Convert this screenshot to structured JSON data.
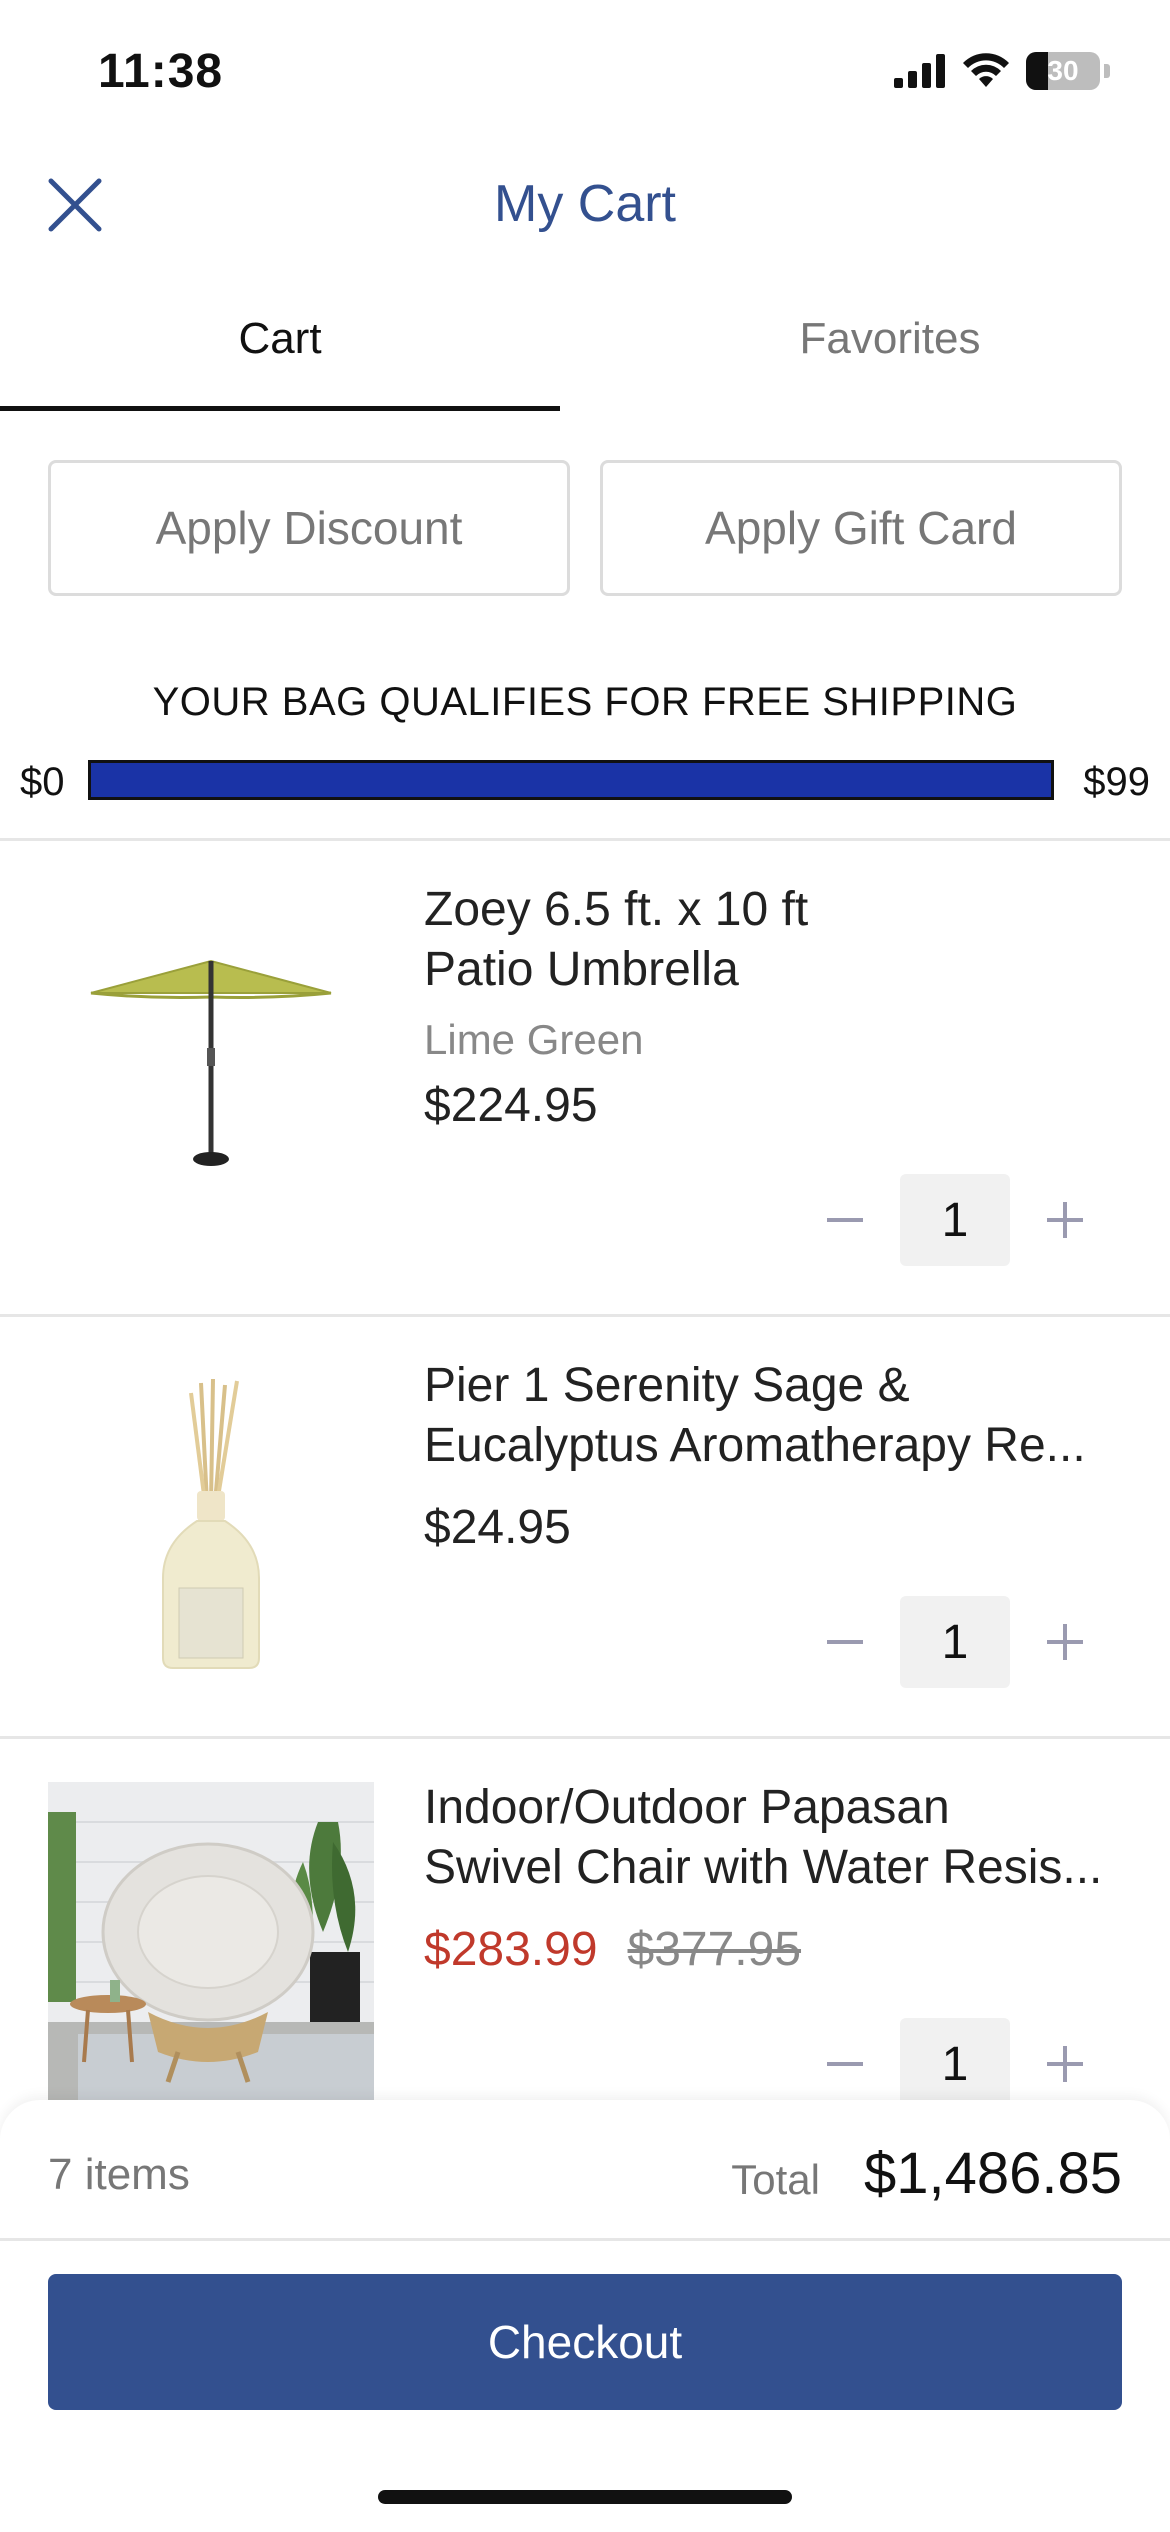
{
  "status_bar": {
    "time": "11:38",
    "battery": "30"
  },
  "header": {
    "title": "My Cart",
    "close_icon": "close-icon"
  },
  "tabs": [
    {
      "label": "Cart",
      "active": true
    },
    {
      "label": "Favorites",
      "active": false
    }
  ],
  "actions": {
    "discount_label": "Apply Discount",
    "gift_card_label": "Apply Gift Card"
  },
  "shipping": {
    "message": "YOUR BAG QUALIFIES FOR FREE SHIPPING",
    "min_label": "$0",
    "max_label": "$99",
    "progress": 1.0,
    "bar_color": "#1a33a6"
  },
  "items": [
    {
      "name_line1": "Zoey 6.5 ft. x 10 ft",
      "name_line2": "Patio Umbrella",
      "variant": "Lime Green",
      "price": "$224.95",
      "quantity": "1"
    },
    {
      "name_line1": "Pier 1 Serenity Sage &",
      "name_line2": "Eucalyptus Aromatherapy Re...",
      "price": "$24.95",
      "quantity": "1"
    },
    {
      "name_line1": "Indoor/Outdoor Papasan",
      "name_line2": "Swivel Chair with Water Resis...",
      "sale_price": "$283.99",
      "original_price": "$377.95",
      "quantity": "1"
    }
  ],
  "footer": {
    "items_count": "7 items",
    "total_label": "Total",
    "total_value": "$1,486.85",
    "checkout_label": "Checkout"
  },
  "colors": {
    "brand": "#33508f",
    "sale": "#c0392b"
  }
}
